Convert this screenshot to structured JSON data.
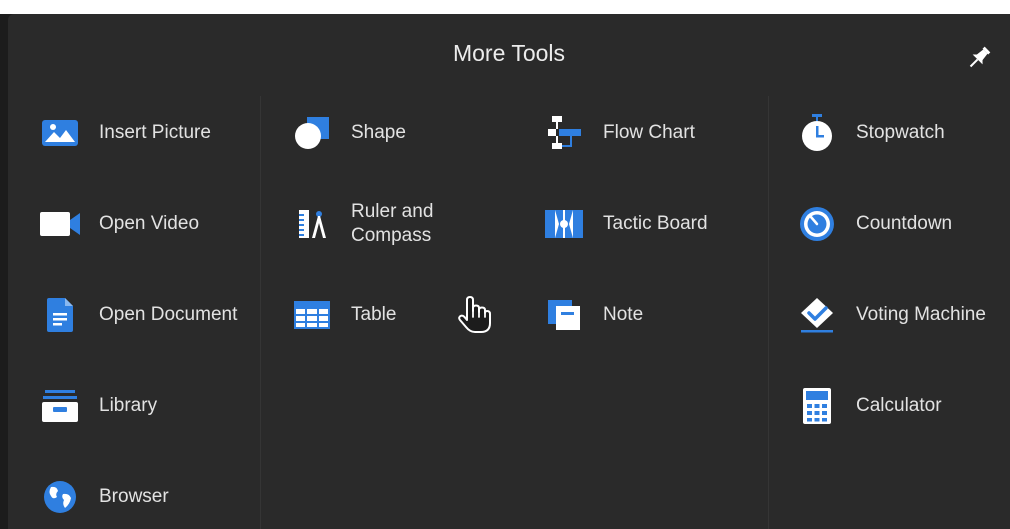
{
  "panel": {
    "title": "More Tools",
    "pin_icon": "pin-icon"
  },
  "tools": {
    "insert_picture": {
      "label": "Insert Picture",
      "icon": "picture-icon"
    },
    "open_video": {
      "label": "Open Video",
      "icon": "video-icon"
    },
    "open_document": {
      "label": "Open Document",
      "icon": "document-icon"
    },
    "library": {
      "label": "Library",
      "icon": "library-icon"
    },
    "browser": {
      "label": "Browser",
      "icon": "globe-icon"
    },
    "shape": {
      "label": "Shape",
      "icon": "shape-icon"
    },
    "ruler_compass": {
      "label": "Ruler and\nCompass",
      "icon": "ruler-compass-icon"
    },
    "table": {
      "label": "Table",
      "icon": "table-icon"
    },
    "flow_chart": {
      "label": "Flow Chart",
      "icon": "flow-chart-icon"
    },
    "tactic_board": {
      "label": "Tactic Board",
      "icon": "tactic-board-icon"
    },
    "note": {
      "label": "Note",
      "icon": "note-icon"
    },
    "stopwatch": {
      "label": "Stopwatch",
      "icon": "stopwatch-icon"
    },
    "countdown": {
      "label": "Countdown",
      "icon": "countdown-icon"
    },
    "voting_machine": {
      "label": "Voting Machine",
      "icon": "voting-machine-icon"
    },
    "calculator": {
      "label": "Calculator",
      "icon": "calculator-icon"
    }
  },
  "colors": {
    "accent": "#2f7fe0",
    "background": "#2a2a2a",
    "text": "#e2e2e2"
  }
}
